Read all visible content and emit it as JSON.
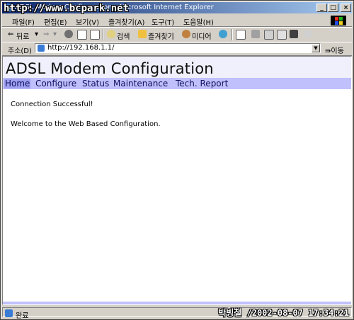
{
  "window": {
    "title": "ADSL Modem Configuration - Microsoft Internet Explorer",
    "watermark": "http://www.bcpark.net",
    "buttons": {
      "minimize": "_",
      "maximize": "□",
      "close": "×"
    }
  },
  "menu": [
    "파일(F)",
    "편집(E)",
    "보기(V)",
    "즐겨찾기(A)",
    "도구(T)",
    "도움말(H)"
  ],
  "toolbar": {
    "back": "뒤로",
    "search": "검색",
    "favorites": "즐겨찾기",
    "media": "미디어"
  },
  "address": {
    "label": "주소(D)",
    "url": "http://192.168.1.1/",
    "go": "이동"
  },
  "page": {
    "title": "ADSL Modem Configuration",
    "nav": [
      "Home",
      "Configure",
      "Status",
      "Maintenance",
      "Tech. Report"
    ],
    "active_nav": "Home",
    "message1": "Connection Successful!",
    "message2": "Welcome to the Web Based Configuration."
  },
  "status": {
    "text": "완료",
    "stamp": "박빙철 /2002-08-07 17:34:21"
  },
  "colors": {
    "header_bg": "#f0f0fc",
    "nav_bg": "#c0c0fc",
    "titlebar_start": "#0a246a",
    "titlebar_end": "#a6caf0"
  }
}
